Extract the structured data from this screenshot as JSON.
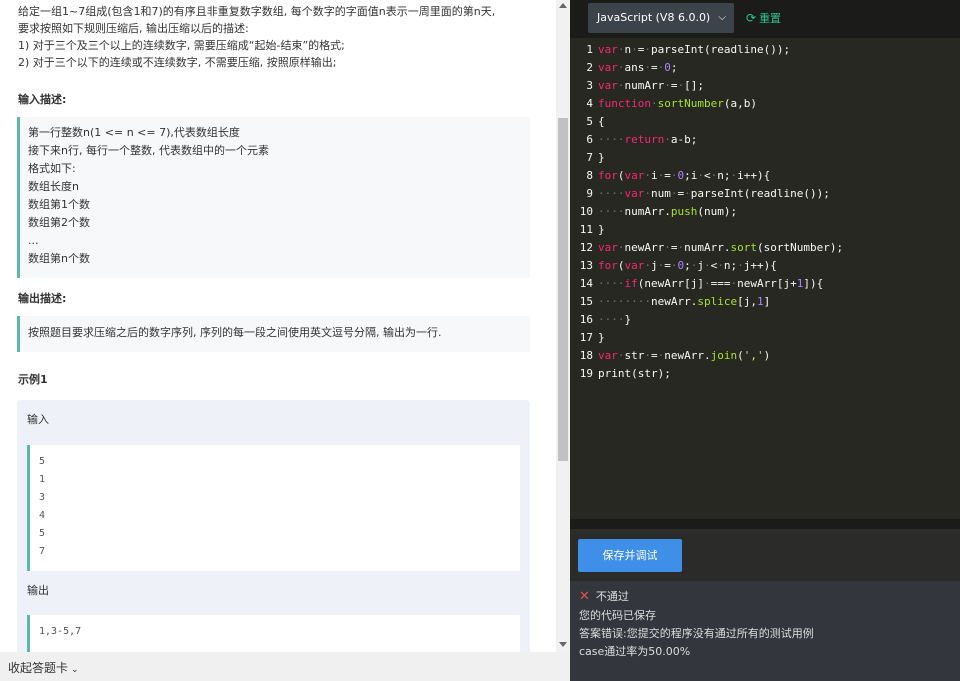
{
  "problem": {
    "description": [
      "给定一组1~7组成(包含1和7)的有序且非重复数字数组, 每个数字的字面值n表示一周里面的第n天,",
      "要求按照如下规则压缩后, 输出压缩以后的描述:",
      "1)   对于三个及三个以上的连续数字, 需要压缩成“起始-结束”的格式;",
      "2)   对于三个以下的连续或不连续数字, 不需要压缩, 按照原样输出;"
    ],
    "input_title": "输入描述:",
    "input_lines": [
      "第一行整数n(1 <= n <= 7),代表数组长度",
      "接下来n行, 每行一个整数, 代表数组中的一个元素",
      "格式如下:",
      "数组长度n",
      "数组第1个数",
      "数组第2个数",
      "...",
      "数组第n个数"
    ],
    "output_title": "输出描述:",
    "output_text": "按照题目要求压缩之后的数字序列, 序列的每一段之间使用英文逗号分隔, 输出为一行.",
    "example_title": "示例1",
    "example_input_label": "输入",
    "example_input": [
      "5",
      "1",
      "3",
      "4",
      "5",
      "7"
    ],
    "example_output_label": "输出",
    "example_output": [
      "1,3-5,7"
    ]
  },
  "bottom": {
    "collapse_label": "收起答题卡",
    "collapse_icon": "chevron-down-icon"
  },
  "toolbar": {
    "language": "JavaScript (V8 6.0.0)",
    "reset_label": "重置"
  },
  "editor": {
    "line_count": 19
  },
  "actions": {
    "save_label": "保存并调试"
  },
  "result": {
    "status": "不通过",
    "lines": [
      "您的代码已保存",
      "答案错误:您提交的程序没有通过所有的测试用例",
      "case通过率为50.00%"
    ]
  },
  "colors": {
    "accent": "#3f8ee8",
    "reset_green": "#2ec28f",
    "fail_red": "#e25050",
    "box_border": "#5cb8a9"
  }
}
